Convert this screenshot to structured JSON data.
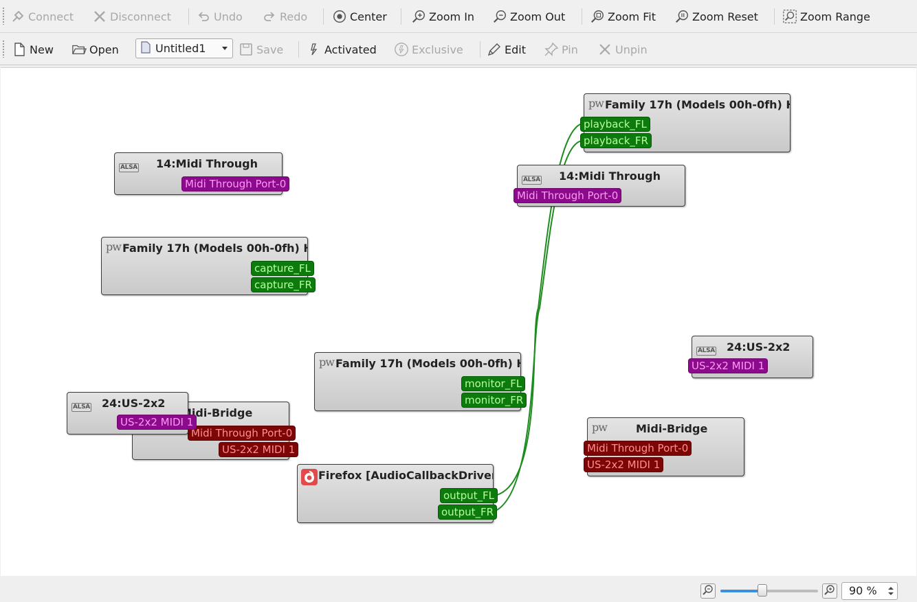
{
  "toolbar_main": {
    "connect": "Connect",
    "disconnect": "Disconnect",
    "undo": "Undo",
    "redo": "Redo",
    "center": "Center",
    "zoom_in": "Zoom In",
    "zoom_out": "Zoom Out",
    "zoom_fit": "Zoom Fit",
    "zoom_reset": "Zoom Reset",
    "zoom_range": "Zoom Range"
  },
  "toolbar_file": {
    "new": "New",
    "open": "Open",
    "preset": "Untitled1",
    "save": "Save",
    "activated": "Activated",
    "exclusive": "Exclusive",
    "edit": "Edit",
    "pin": "Pin",
    "unpin": "Unpin"
  },
  "nodes": {
    "midi_through_in": {
      "title": "14:Midi Through",
      "icon": "alsa-icon",
      "ports": [
        "Midi Through Port-0"
      ]
    },
    "family_capture": {
      "title": "Family 17h (Models 00h-0fh) H...",
      "icon": "pipewire-icon",
      "ports": [
        "capture_FL",
        "capture_FR"
      ]
    },
    "us2x2_in": {
      "title": "24:US-2x2",
      "icon": "alsa-icon",
      "ports": [
        "US-2x2 MIDI 1"
      ]
    },
    "midi_bridge_in": {
      "title": "Midi-Bridge",
      "icon": "pipewire-icon",
      "ports": [
        "Midi Through Port-0",
        "US-2x2 MIDI 1"
      ]
    },
    "family_monitor": {
      "title": "Family 17h (Models 00h-0fh) H...",
      "icon": "pipewire-icon",
      "ports": [
        "monitor_FL",
        "monitor_FR"
      ]
    },
    "firefox": {
      "title": "Firefox [AudioCallbackDriver]",
      "icon": "firefox-icon",
      "ports": [
        "output_FL",
        "output_FR"
      ]
    },
    "family_playback": {
      "title": "Family 17h (Models 00h-0fh) H...",
      "icon": "pipewire-icon",
      "ports": [
        "playback_FL",
        "playback_FR"
      ]
    },
    "midi_through_out": {
      "title": "14:Midi Through",
      "icon": "alsa-icon",
      "ports": [
        "Midi Through Port-0"
      ]
    },
    "us2x2_out": {
      "title": "24:US-2x2",
      "icon": "alsa-icon",
      "ports": [
        "US-2x2 MIDI 1"
      ]
    },
    "midi_bridge_out": {
      "title": "Midi-Bridge",
      "icon": "pipewire-icon",
      "ports": [
        "Midi Through Port-0",
        "US-2x2 MIDI 1"
      ]
    }
  },
  "connections": [
    {
      "from": "Firefox [AudioCallbackDriver]:output_FL",
      "to": "Family 17h:playback_FL"
    },
    {
      "from": "Firefox [AudioCallbackDriver]:output_FR",
      "to": "Family 17h:playback_FR"
    }
  ],
  "status": {
    "zoom": "90 %",
    "zoom_slider_fraction": 0.43
  },
  "colors": {
    "audio_port": "#0c7a0c",
    "midi_port": "#8c0a8c",
    "alsa_midi_port": "#7c0606",
    "wire": "#1e8c1e"
  }
}
